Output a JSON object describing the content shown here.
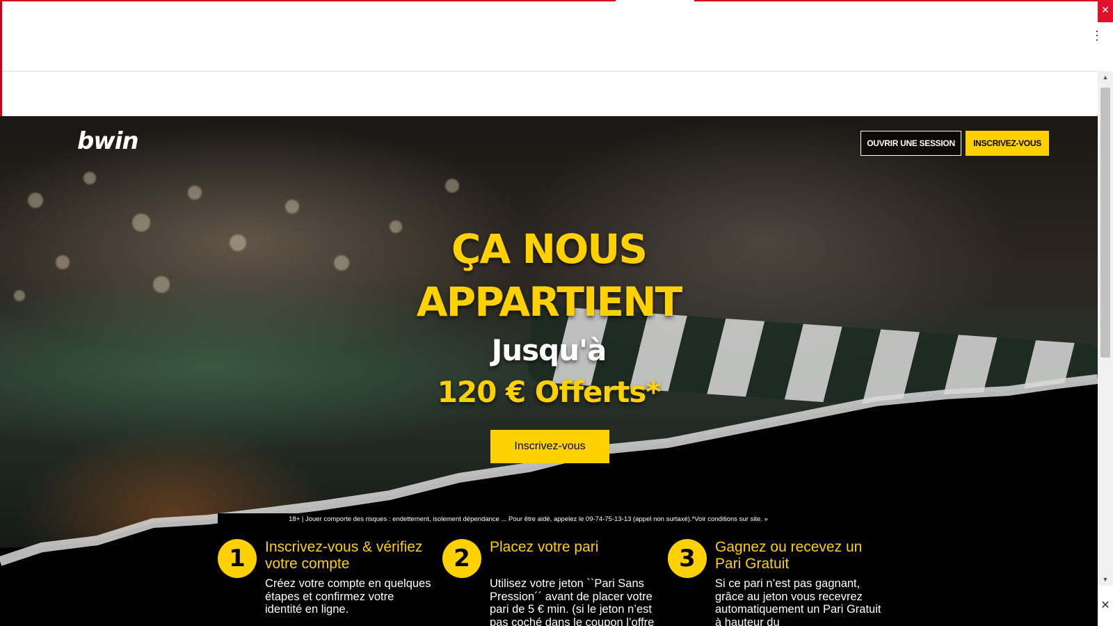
{
  "chrome": {
    "close_glyph": "✕",
    "menu_glyph": "⋮",
    "scroll_up_glyph": "▲",
    "scroll_down_glyph": "▼",
    "bottom_close_glyph": "✕"
  },
  "header": {
    "logo": "bwin",
    "login_label": "OUVRIR UNE SESSION",
    "signup_label": "INSCRIVEZ-VOUS"
  },
  "hero": {
    "line1": "ÇA NOUS",
    "line2": "APPARTIENT",
    "line3": "Jusqu'à",
    "line4": "120 € Offerts*",
    "cta_label": "Inscrivez-vous"
  },
  "disclaimer": "18+ | Jouer comporte des risques : endettement, isolement dépendance ... Pour être aidé, appelez le 09-74-75-13-13 (appel non surtaxé).*Voir conditions sur site. »",
  "steps": [
    {
      "number": "1",
      "title": "Inscrivez-vous & vérifiez votre compte",
      "body": "Créez votre compte en quelques étapes et confirmez votre identité en ligne."
    },
    {
      "number": "2",
      "title": "Placez votre pari",
      "body": "Utilisez votre jeton ``Pari Sans Pression´´ avant de placer votre pari de 5 € min. (si le jeton n’est pas coché dans le coupon l’offre ne"
    },
    {
      "number": "3",
      "title": "Gagnez ou recevez un Pari Gratuit",
      "body": "Si ce pari n’est pas gagnant, grâce au jeton vous recevrez automatiquement un Pari Gratuit à hauteur du"
    }
  ],
  "colors": {
    "accent": "#ffd100",
    "background": "#000000",
    "chrome_red": "#d0021b"
  }
}
